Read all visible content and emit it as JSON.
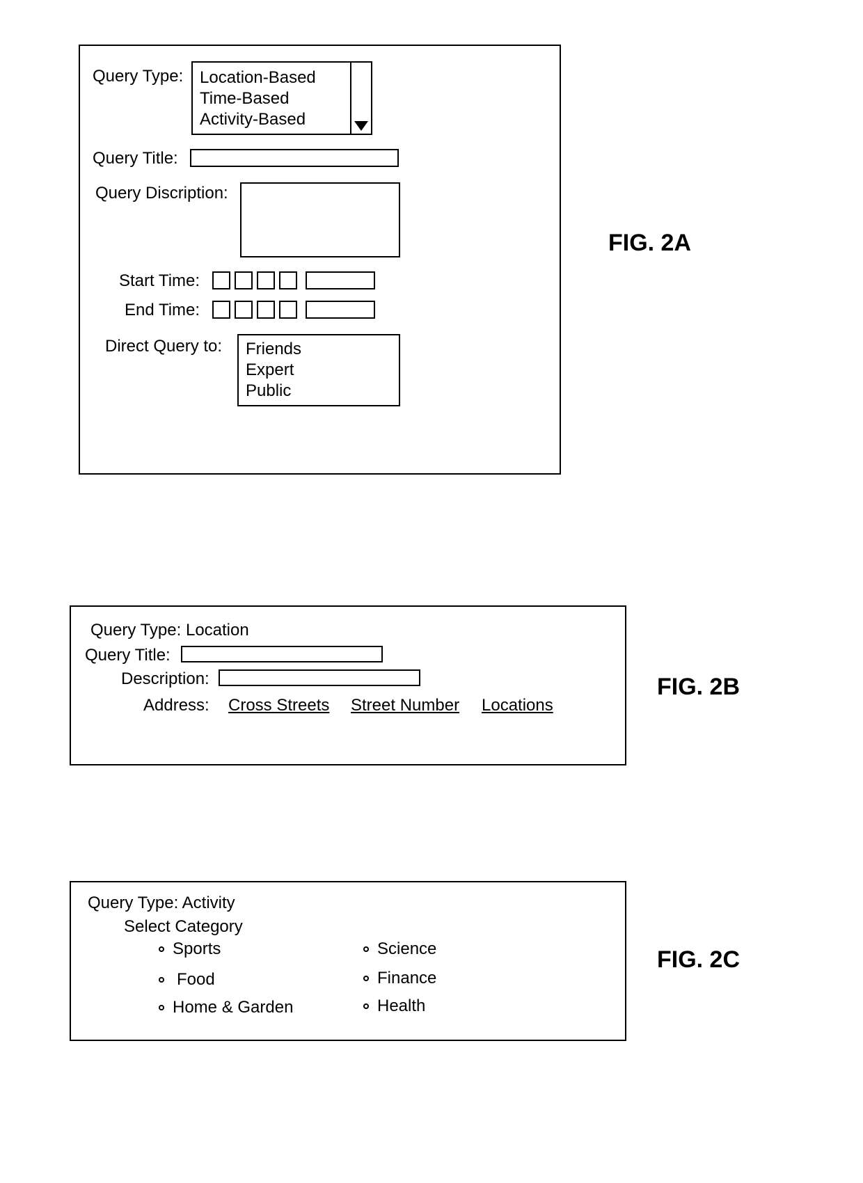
{
  "figA": {
    "caption": "FIG. 2A",
    "labels": {
      "queryType": "Query Type:",
      "queryTitle": "Query Title:",
      "queryDescription": "Query Discription:",
      "startTime": "Start Time:",
      "endTime": "End Time:",
      "directTo": "Direct Query to:"
    },
    "queryTypeOptions": [
      "Location-Based",
      "Time-Based",
      "Activity-Based"
    ],
    "directOptions": [
      "Friends",
      "Expert",
      "Public"
    ]
  },
  "figB": {
    "caption": "FIG. 2B",
    "labels": {
      "queryType": "Query Type:",
      "queryTypeValue": "Location",
      "queryTitle": "Query Title:",
      "description": "Description:",
      "address": "Address:"
    },
    "addressLinks": [
      "Cross Streets",
      "Street Number",
      "Locations"
    ]
  },
  "figC": {
    "caption": "FIG. 2C",
    "labels": {
      "queryType": "Query Type:",
      "queryTypeValue": "Activity",
      "selectCategory": "Select Category"
    },
    "categoriesCol1": [
      "Sports",
      "Food",
      "Home & Garden"
    ],
    "categoriesCol2": [
      "Science",
      "Finance",
      "Health"
    ]
  }
}
